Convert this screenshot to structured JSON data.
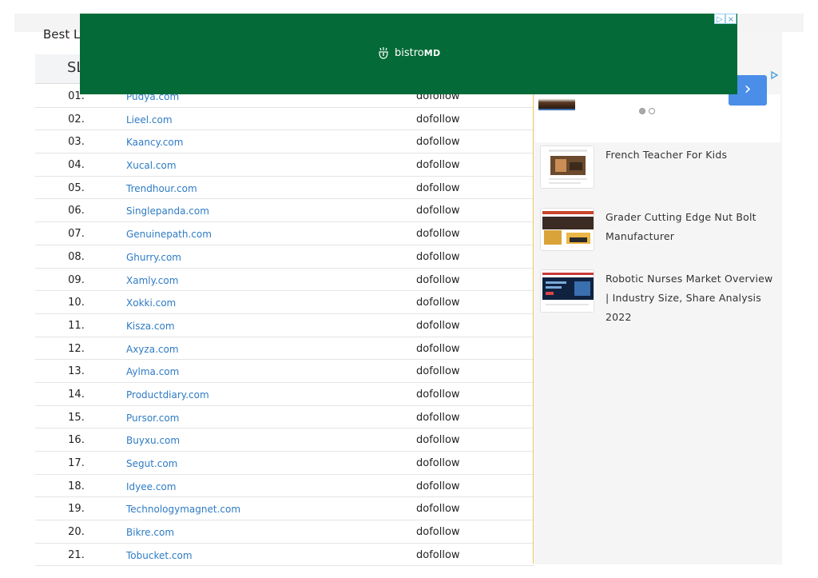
{
  "page": {
    "heading": "Best L",
    "table": {
      "col_sl": "SL",
      "rows": [
        {
          "sl": "01.",
          "site": "Pudya.com",
          "attr": "dofollow"
        },
        {
          "sl": "02.",
          "site": "Lieel.com",
          "attr": "dofollow"
        },
        {
          "sl": "03.",
          "site": "Kaancy.com",
          "attr": "dofollow"
        },
        {
          "sl": "04.",
          "site": "Xucal.com",
          "attr": "dofollow"
        },
        {
          "sl": "05.",
          "site": "Trendhour.com",
          "attr": "dofollow"
        },
        {
          "sl": "06.",
          "site": "Singlepanda.com",
          "attr": "dofollow"
        },
        {
          "sl": "07.",
          "site": "Genuinepath.com",
          "attr": "dofollow"
        },
        {
          "sl": "08.",
          "site": "Ghurry.com",
          "attr": "dofollow"
        },
        {
          "sl": "09.",
          "site": "Xamly.com",
          "attr": "dofollow"
        },
        {
          "sl": "10.",
          "site": "Xokki.com",
          "attr": "dofollow"
        },
        {
          "sl": "11.",
          "site": "Kisza.com",
          "attr": "dofollow"
        },
        {
          "sl": "12.",
          "site": "Axyza.com",
          "attr": "dofollow"
        },
        {
          "sl": "13.",
          "site": "Aylma.com",
          "attr": "dofollow"
        },
        {
          "sl": "14.",
          "site": "Productdiary.com",
          "attr": "dofollow"
        },
        {
          "sl": "15.",
          "site": "Pursor.com",
          "attr": "dofollow"
        },
        {
          "sl": "16.",
          "site": "Buyxu.com",
          "attr": "dofollow"
        },
        {
          "sl": "17.",
          "site": "Segut.com",
          "attr": "dofollow"
        },
        {
          "sl": "18.",
          "site": "Idyee.com",
          "attr": "dofollow"
        },
        {
          "sl": "19.",
          "site": "Technologymagnet.com",
          "attr": "dofollow"
        },
        {
          "sl": "20.",
          "site": "Bikre.com",
          "attr": "dofollow"
        },
        {
          "sl": "21.",
          "site": "Tobucket.com",
          "attr": "dofollow"
        }
      ]
    }
  },
  "sidebar": {
    "ad_next_glyph": "›",
    "posts": [
      {
        "title": "French Teacher For Kids"
      },
      {
        "title": "Grader Cutting Edge Nut Bolt Manufacturer"
      },
      {
        "title": "Robotic Nurses Market Overview | Industry Size, Share Analysis 2022"
      }
    ]
  },
  "banner": {
    "brand_light": "bistro",
    "brand_bold": "MD",
    "color": "#046b38",
    "flag_play": "▷",
    "flag_close": "×"
  },
  "colors": {
    "link": "#2e7bc4",
    "sidebar_bg": "#f5f5f5",
    "divider": "#e8c45c",
    "next_button": "#4a8ee8"
  },
  "icons": [
    "ad-play-icon",
    "ad-close-icon",
    "chevron-right-icon",
    "bistromd-logo-icon",
    "ad-choices-icon"
  ]
}
